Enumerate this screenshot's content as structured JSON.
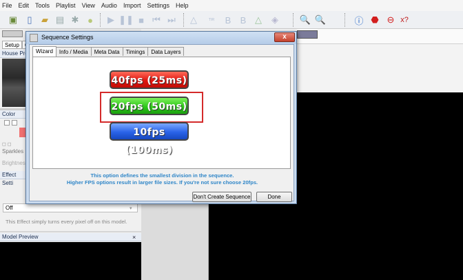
{
  "menu": [
    "File",
    "Edit",
    "Tools",
    "Playlist",
    "View",
    "Audio",
    "Import",
    "Settings",
    "Help"
  ],
  "left_panel": {
    "setup_tab": "Setup",
    "second_tab": "C",
    "house_preview": "House Prev",
    "color_label": "Color",
    "sparkles_label": "Sparkles",
    "brightness_label": "Brightnes",
    "effect_settings": "Effect Setti",
    "off_value": "Off",
    "effect_desc": "This Effect simply turns every pixel off on this model.",
    "model_preview": "Model Preview",
    "close_x": "×"
  },
  "dialog": {
    "title": "Sequence Settings",
    "close_label": "x",
    "tabs": [
      "Wizard",
      "Info / Media",
      "Meta Data",
      "Timings",
      "Data Layers"
    ],
    "options": {
      "fps40": "40fps (25ms)",
      "fps20": "20fps (50ms)",
      "fps10": "10fps (100ms)"
    },
    "info_line1": "This option defines the smallest division in the sequence.",
    "info_line2": "Higher FPS options result in larger file sizes.  If you're not sure choose 20fps.",
    "dont_create": "Don't Create Sequence",
    "done": "Done"
  }
}
